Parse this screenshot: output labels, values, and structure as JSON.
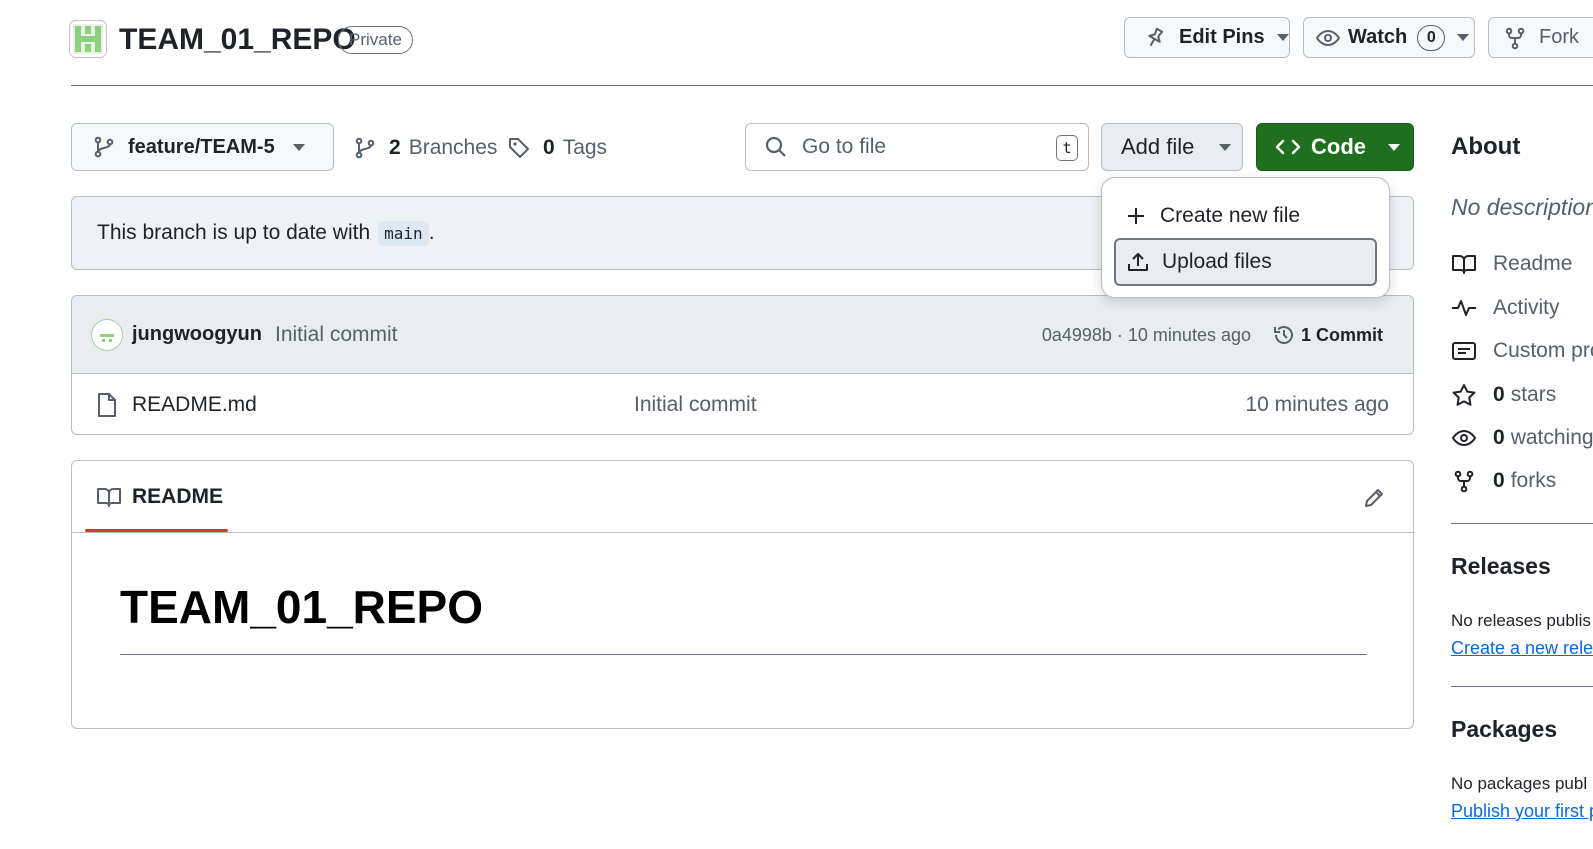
{
  "repo": {
    "name": "TEAM_01_REPO",
    "visibility": "Private"
  },
  "header_actions": {
    "edit_pins": "Edit Pins",
    "watch": "Watch",
    "watch_count": "0",
    "fork": "Fork"
  },
  "toolbar": {
    "branch": "feature/TEAM-5",
    "branches_count": "2",
    "branches_label": "Branches",
    "tags_count": "0",
    "tags_label": "Tags",
    "go_to_file_placeholder": "Go to file",
    "go_to_file_shortcut": "t",
    "add_file": "Add file",
    "code": "Code"
  },
  "add_file_menu": {
    "items": [
      {
        "label": "Create new file"
      },
      {
        "label": "Upload files"
      }
    ]
  },
  "branch_status": {
    "text": "This branch is up to date with",
    "branch": "main",
    "suffix": "."
  },
  "latest_commit": {
    "author": "jungwoogyun",
    "message": "Initial commit",
    "hash": "0a4998b",
    "separator": "·",
    "time": "10 minutes ago",
    "commits_label": "1 Commit"
  },
  "files": [
    {
      "name": "README.md",
      "message": "Initial commit",
      "time": "10 minutes ago"
    }
  ],
  "readme": {
    "tab_label": "README",
    "heading": "TEAM_01_REPO"
  },
  "sidebar": {
    "about_title": "About",
    "description": "No description",
    "readme": "Readme",
    "activity": "Activity",
    "custom_properties": "Custom pro",
    "stars_count": "0",
    "stars_label": "stars",
    "watching_count": "0",
    "watching_label": "watching",
    "forks_count": "0",
    "forks_label": "forks",
    "releases_title": "Releases",
    "releases_text": "No releases publis",
    "releases_link": "Create a new relea",
    "packages_title": "Packages",
    "packages_text": "No packages publ",
    "packages_link": "Publish your first p"
  },
  "colors": {
    "accent_green": "#1f6f1f",
    "underline_red": "#c0412c",
    "link_blue": "#0969da"
  }
}
